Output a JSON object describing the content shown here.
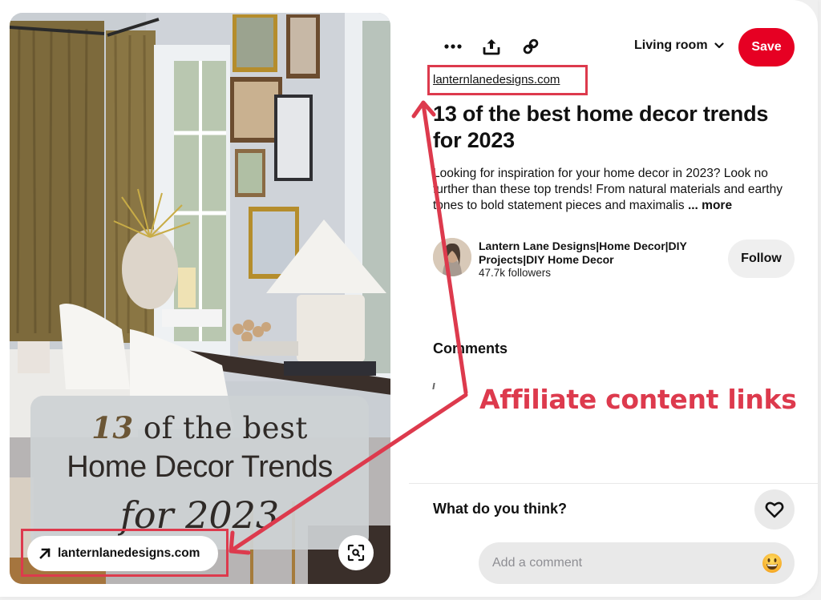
{
  "toolbar": {
    "more_icon": "more-horizontal-icon",
    "share_icon": "share-upload-icon",
    "link_icon": "copy-link-icon",
    "board_name": "Living room",
    "board_chevron": "chevron-down-icon",
    "save_label": "Save"
  },
  "pin": {
    "source_domain": "lanternlanedesigns.com",
    "title": "13 of the best home decor trends for 2023",
    "description": "Looking for inspiration for your home decor in 2023? Look no further than these top trends! From natural materials and earthy tones to bold statement pieces and maximalis",
    "more_label": "... more"
  },
  "image": {
    "overlay_line1_number": "13",
    "overlay_line1_rest": " of the best",
    "overlay_line2": "Home Decor Trends",
    "overlay_line3": "for 2023",
    "domain_pill_label": "lanternlanedesigns.com",
    "visual_search_icon": "visual-search-icon"
  },
  "creator": {
    "name": "Lantern Lane Designs|Home Decor|DIY Projects|DIY Home Decor",
    "followers": "47.7k followers",
    "follow_label": "Follow"
  },
  "comments": {
    "heading": "Comments",
    "prompt": "What do you think?",
    "input_placeholder": "Add a comment",
    "input_value": "",
    "emoji_icon": "smiley-emoji-icon",
    "like_icon": "heart-outline-icon"
  },
  "annotation": {
    "label": "Affiliate content links",
    "color": "#dd3a4d"
  },
  "colors": {
    "save_button": "#e60023",
    "pill_background": "#efefef",
    "annotation": "#dd3a4d"
  }
}
